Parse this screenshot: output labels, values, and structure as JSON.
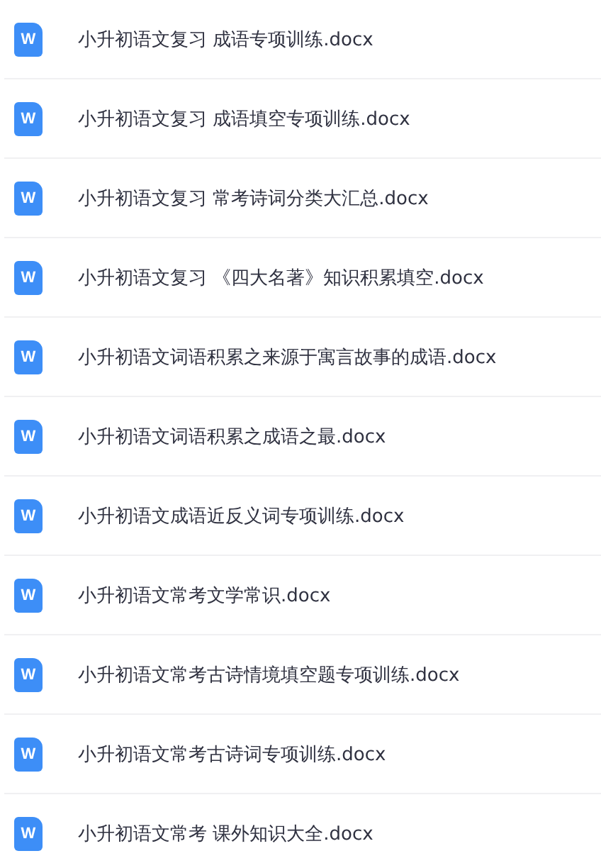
{
  "files": [
    {
      "icon": "W",
      "name": "小升初语文复习 成语专项训练.docx"
    },
    {
      "icon": "W",
      "name": "小升初语文复习 成语填空专项训练.docx"
    },
    {
      "icon": "W",
      "name": "小升初语文复习 常考诗词分类大汇总.docx"
    },
    {
      "icon": "W",
      "name": "小升初语文复习 《四大名著》知识积累填空.docx"
    },
    {
      "icon": "W",
      "name": "小升初语文词语积累之来源于寓言故事的成语.docx"
    },
    {
      "icon": "W",
      "name": "小升初语文词语积累之成语之最.docx"
    },
    {
      "icon": "W",
      "name": "小升初语文成语近反义词专项训练.docx"
    },
    {
      "icon": "W",
      "name": "小升初语文常考文学常识.docx"
    },
    {
      "icon": "W",
      "name": "小升初语文常考古诗情境填空题专项训练.docx"
    },
    {
      "icon": "W",
      "name": "小升初语文常考古诗词专项训练.docx"
    },
    {
      "icon": "W",
      "name": "小升初语文常考 课外知识大全.docx"
    }
  ]
}
